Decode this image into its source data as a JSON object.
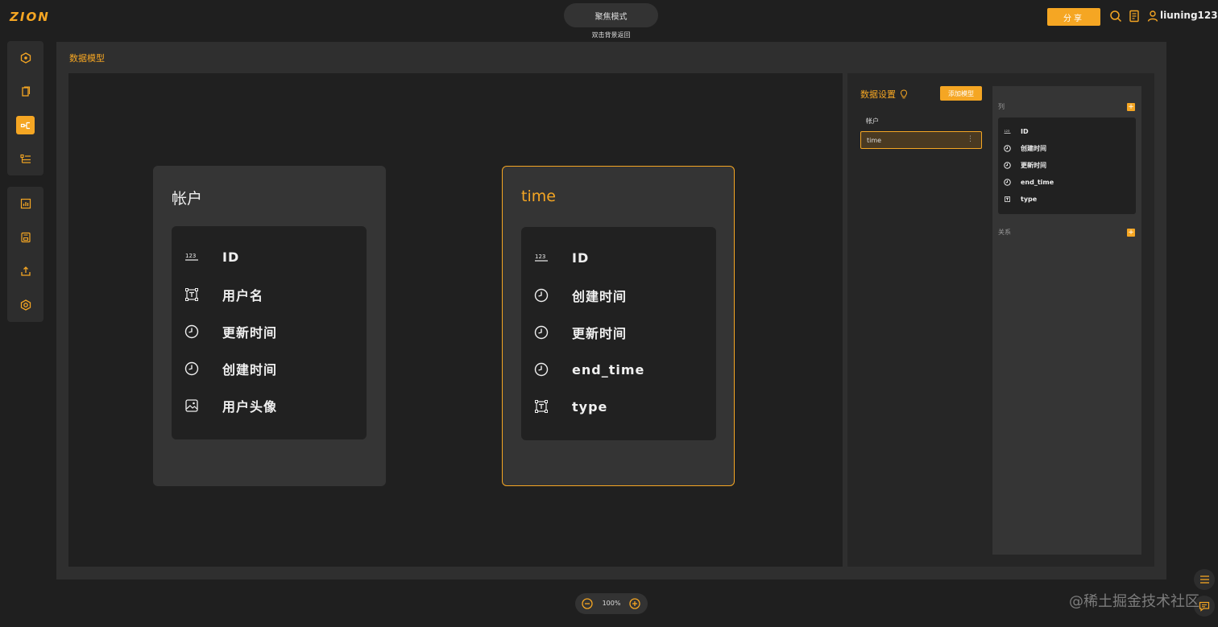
{
  "app": {
    "logo": "ZION"
  },
  "header": {
    "focus_mode": "聚焦模式",
    "focus_hint": "双击背景返回",
    "share_label": "分享",
    "username": "liuning123"
  },
  "panel": {
    "title": "数据模型"
  },
  "models": [
    {
      "name": "帐户",
      "fields": [
        {
          "icon": "number-icon",
          "label": "ID"
        },
        {
          "icon": "text-icon",
          "label": "用户名"
        },
        {
          "icon": "clock-icon",
          "label": "更新时间"
        },
        {
          "icon": "clock-icon",
          "label": "创建时间"
        },
        {
          "icon": "image-icon",
          "label": "用户头像"
        }
      ]
    },
    {
      "name": "time",
      "fields": [
        {
          "icon": "number-icon",
          "label": "ID"
        },
        {
          "icon": "clock-icon",
          "label": "创建时间"
        },
        {
          "icon": "clock-icon",
          "label": "更新时间"
        },
        {
          "icon": "clock-icon",
          "label": "end_time"
        },
        {
          "icon": "text-icon",
          "label": "type"
        }
      ]
    }
  ],
  "settings": {
    "title": "数据设置",
    "add_model_label": "添加模型",
    "model_list": [
      "帐户",
      "time"
    ],
    "selected_model": "time",
    "columns_label": "列",
    "relations_label": "关系",
    "columns": [
      {
        "icon": "number-icon",
        "label": "ID"
      },
      {
        "icon": "clock-icon",
        "label": "创建时间"
      },
      {
        "icon": "clock-icon",
        "label": "更新时间"
      },
      {
        "icon": "clock-icon",
        "label": "end_time"
      },
      {
        "icon": "text-icon",
        "label": "type"
      }
    ]
  },
  "zoom": {
    "value": "100%"
  },
  "watermark": "@稀土掘金技术社区",
  "colors": {
    "accent": "#f5a623",
    "background": "#1f1f1f"
  }
}
